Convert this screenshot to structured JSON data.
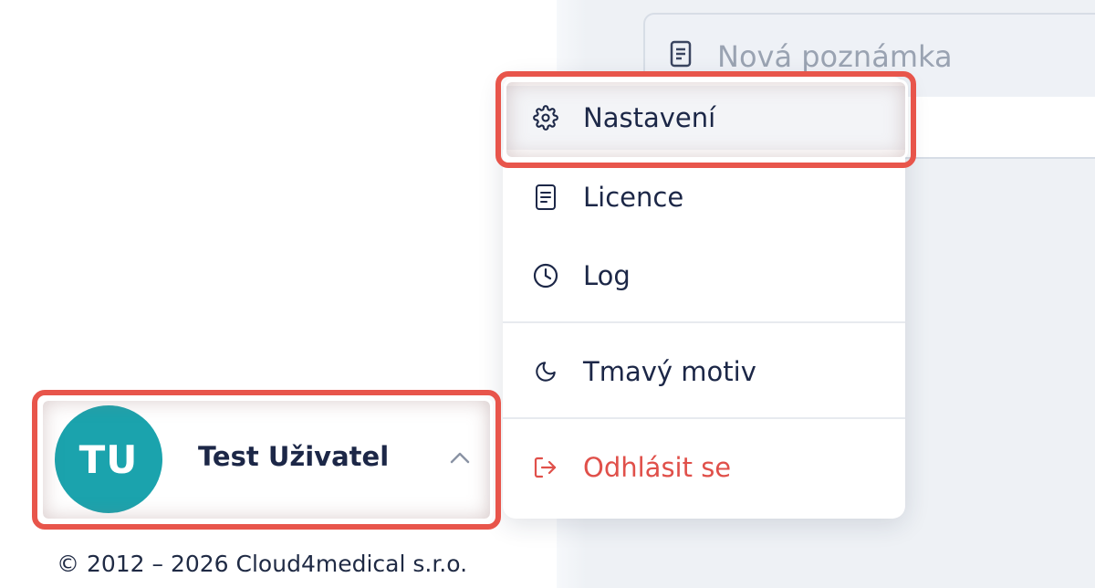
{
  "note": {
    "placeholder": "Nová poznámka",
    "icon": "note-icon"
  },
  "menu": {
    "items": [
      {
        "label": "Nastavení",
        "icon": "gear-icon"
      },
      {
        "label": "Licence",
        "icon": "document-icon"
      },
      {
        "label": "Log",
        "icon": "clock-icon"
      },
      {
        "label": "Tmavý motiv",
        "icon": "moon-icon"
      },
      {
        "label": "Odhlásit se",
        "icon": "logout-icon"
      }
    ]
  },
  "user": {
    "initials": "TU",
    "name": "Test Uživatel",
    "avatar_color": "#1ba3ad"
  },
  "footer": {
    "copyright": "© 2012 – 2026 Cloud4medical s.r.o."
  },
  "colors": {
    "highlight": "#e8554b",
    "logout": "#e0504a",
    "text": "#1c2747"
  }
}
